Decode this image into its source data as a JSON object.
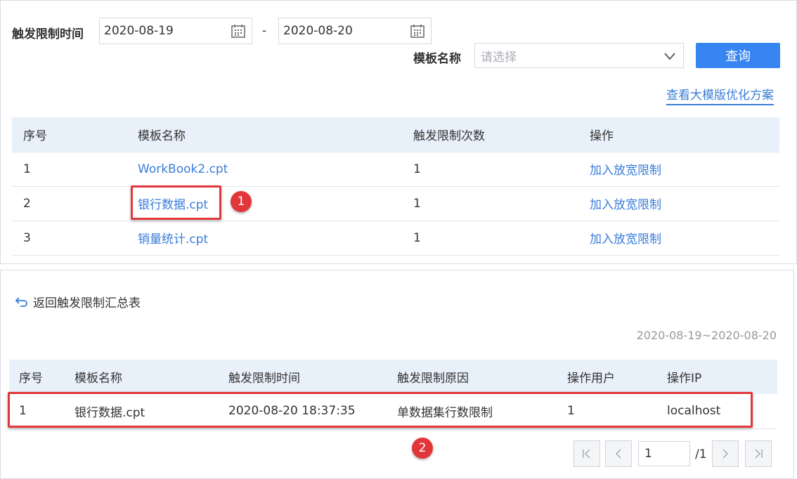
{
  "filter": {
    "time_label": "触发限制时间",
    "start_date": "2020-08-19",
    "end_date": "2020-08-20",
    "separator": "-",
    "template_label": "模板名称",
    "template_placeholder": "请选择",
    "query_button": "查询",
    "optimize_link": "查看大模版优化方案"
  },
  "summary_table": {
    "headers": [
      "序号",
      "模板名称",
      "触发限制次数",
      "操作"
    ],
    "rows": [
      {
        "index": "1",
        "name": "WorkBook2.cpt",
        "count": "1",
        "action": "加入放宽限制"
      },
      {
        "index": "2",
        "name": "银行数据.cpt",
        "count": "1",
        "action": "加入放宽限制"
      },
      {
        "index": "3",
        "name": "销量统计.cpt",
        "count": "1",
        "action": "加入放宽限制"
      }
    ]
  },
  "detail": {
    "back_link": "返回触发限制汇总表",
    "date_range": "2020-08-19~2020-08-20",
    "headers": [
      "序号",
      "模板名称",
      "触发限制时间",
      "触发限制原因",
      "操作用户",
      "操作IP"
    ],
    "rows": [
      {
        "index": "1",
        "name": "银行数据.cpt",
        "time": "2020-08-20 18:37:35",
        "reason": "单数据集行数限制",
        "user": "1",
        "ip": "localhost"
      }
    ]
  },
  "pagination": {
    "current_page": "1",
    "total_pages": "/1"
  },
  "annotations": {
    "badge_1": "1",
    "badge_2": "2"
  },
  "colors": {
    "accent": "#3685f2",
    "link": "#3a7dd8",
    "highlight": "#e2373a",
    "table_header": "#e8f0fa"
  }
}
